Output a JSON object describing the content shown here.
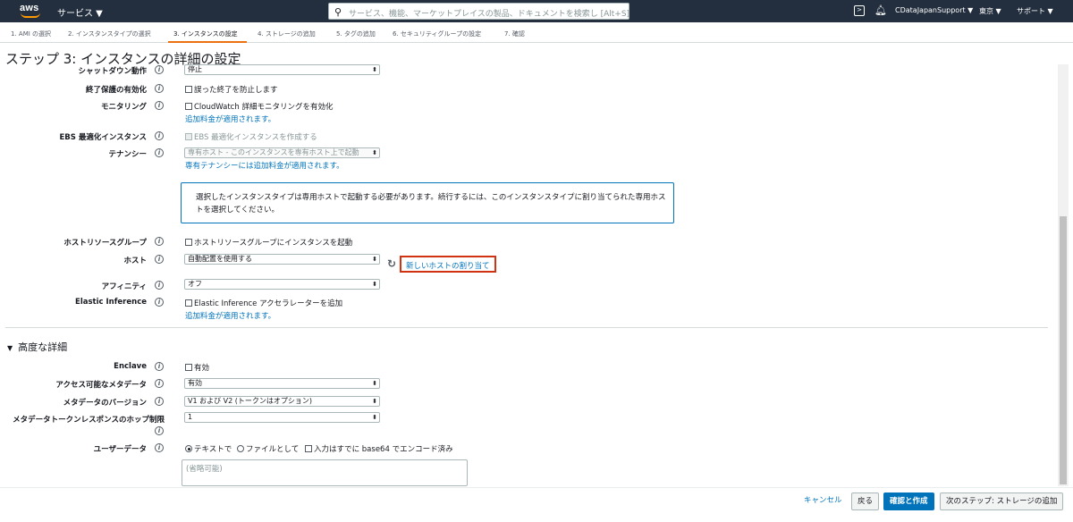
{
  "topbar": {
    "logo": "aws",
    "services": "サービス ▼",
    "search_placeholder": "サービス、機能、マーケットプレイスの製品、ドキュメントを検索し [Alt+S]",
    "account": "CDataJapanSupport ▼",
    "region": "東京 ▼",
    "support": "サポート ▼"
  },
  "tabs": [
    {
      "label": "1. AMI の選択"
    },
    {
      "label": "2. インスタンスタイプの選択"
    },
    {
      "label": "3. インスタンスの設定"
    },
    {
      "label": "4. ストレージの追加"
    },
    {
      "label": "5. タグの追加"
    },
    {
      "label": "6. セキュリティグループの設定"
    },
    {
      "label": "7. 確認"
    }
  ],
  "title": "ステップ 3: インスタンスの詳細の設定",
  "form": {
    "shutdown": {
      "label": "シャットダウン動作",
      "value": "停止"
    },
    "termination": {
      "label": "終了保護の有効化",
      "checkbox": "誤った終了を防止します"
    },
    "monitoring": {
      "label": "モニタリング",
      "checkbox": "CloudWatch 詳細モニタリングを有効化",
      "link": "追加料金が適用されます。"
    },
    "ebs": {
      "label": "EBS 最適化インスタンス",
      "checkbox": "EBS 最適化インスタンスを作成する"
    },
    "tenancy": {
      "label": "テナンシー",
      "value": "専有ホスト - このインスタンスを専有ホスト上で起動",
      "link": "専有テナンシーには追加料金が適用されます。"
    },
    "alert": "選択したインスタンスタイプは専用ホストで起動する必要があります。続行するには、このインスタンスタイプに割り当てられた専用ホストを選択してください。",
    "host_group": {
      "label": "ホストリソースグループ",
      "checkbox": "ホストリソースグループにインスタンスを起動"
    },
    "host": {
      "label": "ホスト",
      "value": "自動配置を使用する",
      "link": "新しいホストの割り当て"
    },
    "affinity": {
      "label": "アフィニティ",
      "value": "オフ"
    },
    "elastic": {
      "label": "Elastic Inference",
      "checkbox": "Elastic Inference アクセラレーターを追加",
      "link": "追加料金が適用されます。"
    }
  },
  "advanced": {
    "heading": "高度な詳細",
    "enclave": {
      "label": "Enclave",
      "checkbox": "有効"
    },
    "metadata_access": {
      "label": "アクセス可能なメタデータ",
      "value": "有効"
    },
    "metadata_version": {
      "label": "メタデータのバージョン",
      "value": "V1 および V2 (トークンはオプション)"
    },
    "hop_limit": {
      "label": "メタデータトークンレスポンスのホップ制限",
      "value": "1"
    },
    "userdata": {
      "label": "ユーザーデータ",
      "radio_text": "テキストで",
      "radio_file": "ファイルとして",
      "checkbox": "入力はすでに base64 でエンコード済み",
      "placeholder": "(省略可能)"
    }
  },
  "footer": {
    "cancel": "キャンセル",
    "back": "戻る",
    "review": "確認と作成",
    "next": "次のステップ: ストレージの追加"
  }
}
